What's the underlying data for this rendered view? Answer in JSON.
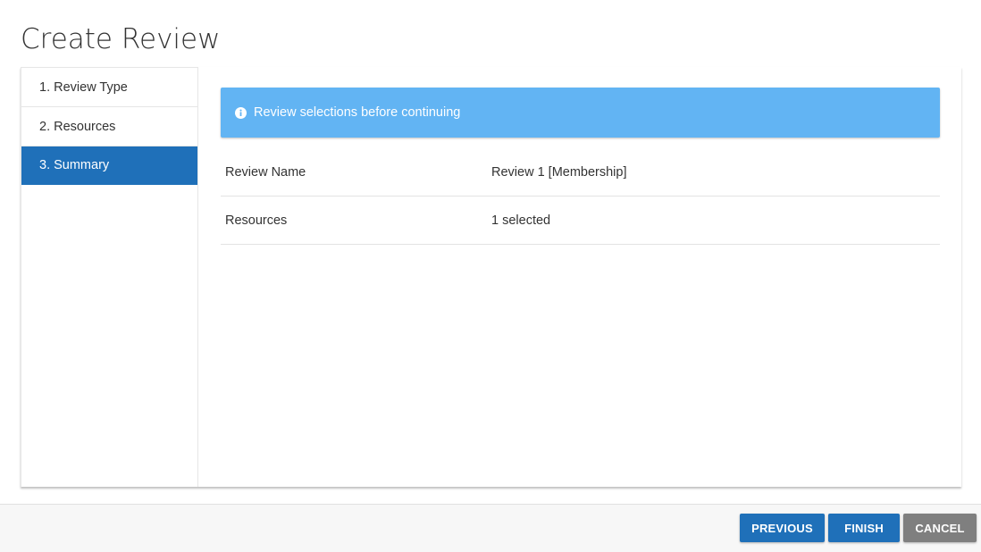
{
  "page": {
    "title": "Create Review"
  },
  "steps": [
    {
      "label": "1. Review Type",
      "active": false
    },
    {
      "label": "2. Resources",
      "active": false
    },
    {
      "label": "3. Summary",
      "active": true
    }
  ],
  "alert": {
    "icon": "info-icon",
    "message": "Review selections before continuing",
    "color": "#62b4f3"
  },
  "summary": {
    "rows": [
      {
        "label": "Review Name",
        "value": "Review 1 [Membership]"
      },
      {
        "label": "Resources",
        "value": "1 selected"
      }
    ]
  },
  "footer": {
    "previous_label": "PREVIOUS",
    "finish_label": "FINISH",
    "cancel_label": "CANCEL"
  },
  "colors": {
    "primary": "#1f70b9",
    "cancel": "#7f7f7f",
    "alert": "#62b4f3"
  }
}
